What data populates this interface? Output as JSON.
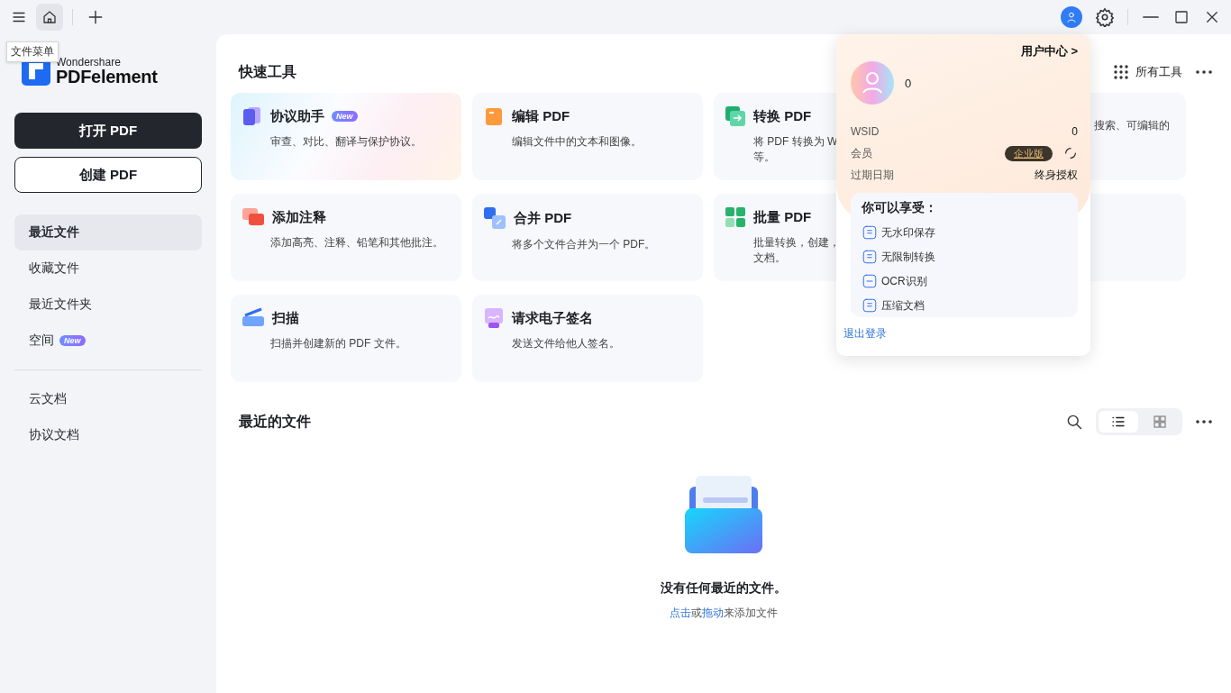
{
  "titlebar": {
    "tooltip": "文件菜单",
    "home_selected": true
  },
  "logo": {
    "brand": "Wondershare",
    "product": "PDFelement"
  },
  "sidebar": {
    "primary_button": "打开 PDF",
    "secondary_button": "创建 PDF",
    "items": [
      {
        "label": "最近文件",
        "selected": true
      },
      {
        "label": "收藏文件",
        "selected": false
      },
      {
        "label": "最近文件夹",
        "selected": false
      },
      {
        "label": "空间",
        "selected": false,
        "badge": "New"
      }
    ],
    "cloud_items": [
      {
        "label": "云文档",
        "selected": false
      },
      {
        "label": "协议文档",
        "selected": false
      }
    ]
  },
  "quick_tools": {
    "title": "快速工具",
    "all_tools": "所有工具",
    "tools": [
      {
        "kind": "tool",
        "title": "协议助手",
        "badge": "New",
        "highlight": true,
        "desc_lines": [
          "审查、对比、翻译与保护协议。"
        ]
      },
      {
        "kind": "tool",
        "title": "编辑 PDF",
        "highlight": false,
        "desc_lines": [
          "编辑文件中的文本和图像。"
        ]
      },
      {
        "kind": "tool",
        "title": "转换 PDF",
        "highlight": false,
        "desc_lines": [
          "将 PDF 转换为 W",
          "等。"
        ]
      },
      {
        "kind": "covered",
        "desc_lines": [
          "搜索、可编辑的"
        ]
      },
      {
        "kind": "tool",
        "title": "添加注释",
        "highlight": false,
        "desc_lines": [
          "添加高亮、注释、铅笔和其他批注。"
        ]
      },
      {
        "kind": "tool",
        "title": "合并 PDF",
        "highlight": false,
        "desc_lines": [
          "将多个文件合并为一个 PDF。"
        ]
      },
      {
        "kind": "tool",
        "title": "批量 PDF",
        "highlight": false,
        "desc_lines": [
          "批量转换，创建，",
          "文档。"
        ]
      },
      {
        "kind": "covered"
      },
      {
        "kind": "tool",
        "title": "扫描",
        "highlight": false,
        "desc_lines": [
          "扫描并创建新的 PDF 文件。"
        ]
      },
      {
        "kind": "tool",
        "title": "请求电子签名",
        "highlight": false,
        "desc_lines": [
          "发送文件给他人签名。"
        ]
      }
    ]
  },
  "recent": {
    "title": "最近的文件",
    "views": [
      {
        "kind": "list",
        "selected": true
      },
      {
        "kind": "grid",
        "selected": false
      }
    ],
    "empty_title": "没有任何最近的文件。",
    "empty_hint": {
      "link1": "点击",
      "mid": "或",
      "link2": "拖动",
      "rest": "来添加文件"
    }
  },
  "account_popup": {
    "user_center": "用户中心 >",
    "name": "0",
    "rows": [
      {
        "kind": "text",
        "label": "WSID",
        "value": "0"
      },
      {
        "kind": "badge",
        "label": "会员",
        "value": "企业版"
      },
      {
        "kind": "text",
        "label": "过期日期",
        "value": "终身授权"
      }
    ],
    "benefits_title": "你可以享受：",
    "benefits": [
      "无水印保存",
      "无限制转换",
      "OCR识别",
      "压缩文档"
    ],
    "logout": "退出登录"
  }
}
